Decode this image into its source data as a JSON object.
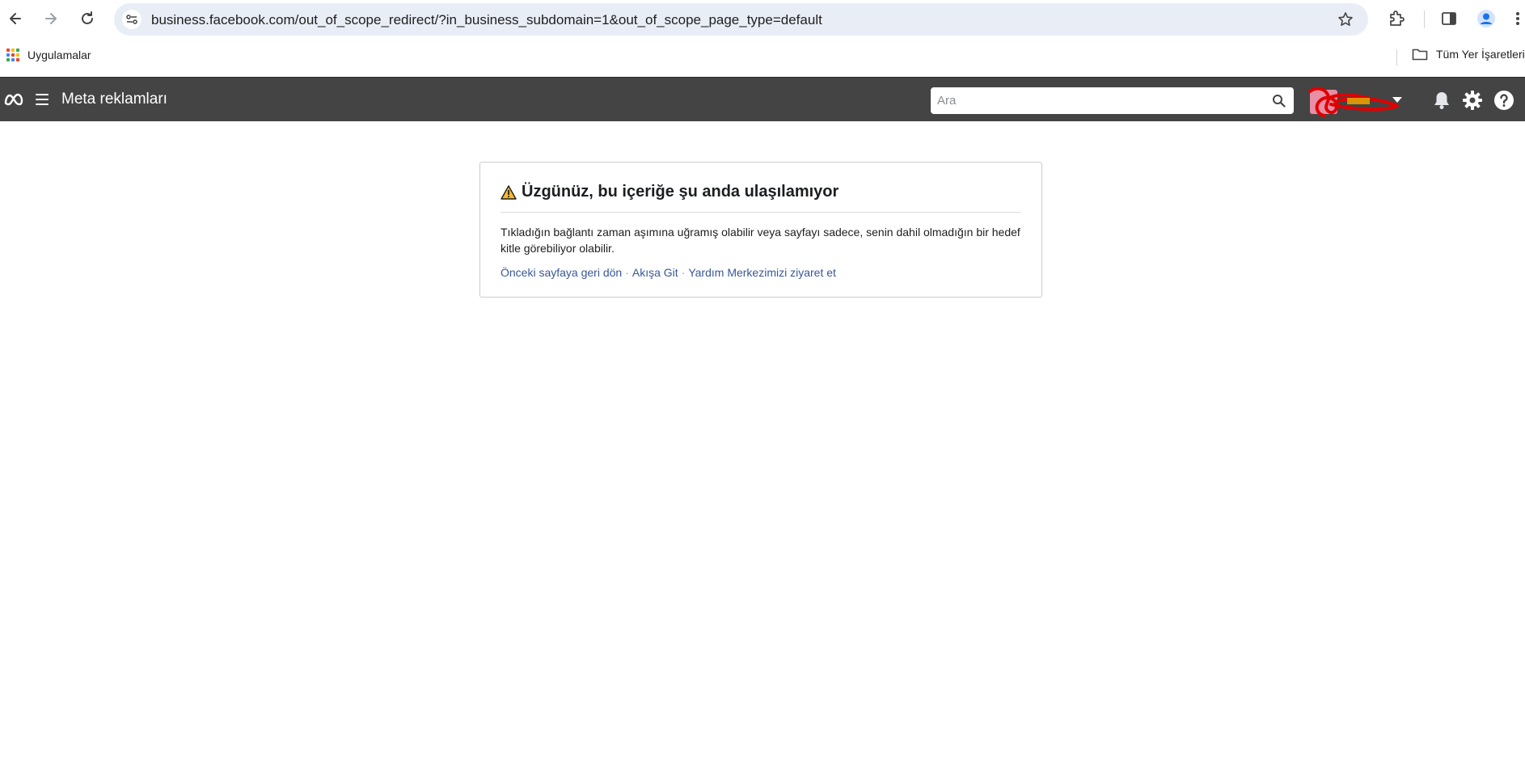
{
  "browser": {
    "url": "business.facebook.com/out_of_scope_redirect/?in_business_subdomain=1&out_of_scope_page_type=default",
    "bookmarks": {
      "apps_label": "Uygulamalar",
      "all_bookmarks_label": "Tüm Yer İşaretleri"
    },
    "icons": [
      "back-icon",
      "forward-icon",
      "reload-icon",
      "site-info-icon",
      "star-icon",
      "extensions-icon",
      "side-panel-icon",
      "profile-icon",
      "more-icon",
      "folder-icon"
    ]
  },
  "header": {
    "title": "Meta reklamları",
    "search_placeholder": "Ara",
    "icons": [
      "meta-logo-icon",
      "menu-icon",
      "search-icon",
      "bell-icon",
      "gear-icon",
      "help-icon"
    ],
    "bg_color": "#444444"
  },
  "error": {
    "title": "Üzgünüz, bu içeriğe şu anda ulaşılamıyor",
    "description": "Tıkladığın bağlantı zaman aşımına uğramış olabilir veya sayfayı sadece, senin dahil olmadığın bir hedef kitle görebiliyor olabilir.",
    "links": {
      "back": "Önceki sayfaya geri dön",
      "feed": "Akışa Git",
      "help": "Yardım Merkezimizi ziyaret et",
      "separator": "·"
    },
    "link_color": "#385898"
  }
}
